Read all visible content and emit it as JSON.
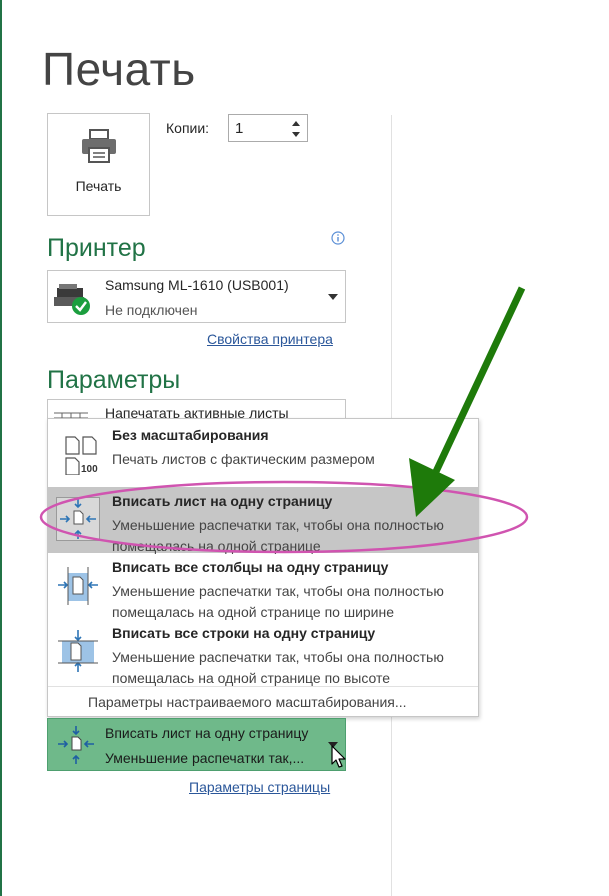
{
  "page": {
    "title": "Печать"
  },
  "print_button": {
    "label": "Печать"
  },
  "copies": {
    "label": "Копии:",
    "value": "1"
  },
  "printer": {
    "section_title": "Принтер",
    "name": "Samsung ML-1610 (USB001)",
    "status": "Не подключен",
    "properties_link": "Свойства принтера"
  },
  "settings": {
    "section_title": "Параметры",
    "active_sheets_text": "Напечатать активные листы"
  },
  "scaling_menu": {
    "items": [
      {
        "title": "Без масштабирования",
        "desc": "Печать листов с фактическим размером",
        "icon": "no-scaling-icon",
        "icon_label": "100"
      },
      {
        "title": "Вписать лист на одну страницу",
        "desc": "Уменьшение распечатки так, чтобы она полностью помещалась на одной странице",
        "icon": "fit-sheet-icon"
      },
      {
        "title": "Вписать все столбцы на одну страницу",
        "desc": "Уменьшение распечатки так, чтобы она полностью помещалась на одной странице по ширине",
        "icon": "fit-columns-icon"
      },
      {
        "title": "Вписать все строки на одну страницу",
        "desc": "Уменьшение распечатки так, чтобы она полностью помещалась на одной странице по высоте",
        "icon": "fit-rows-icon"
      }
    ],
    "custom_options": "Параметры настраиваемого масштабирования..."
  },
  "scaling_select": {
    "title": "Вписать лист на одну страницу",
    "desc": "Уменьшение распечатки так,..."
  },
  "page_setup_link": "Параметры страницы",
  "colors": {
    "accent": "#217346",
    "link": "#2b579a",
    "annotation_arrow": "#1e7a0a",
    "annotation_ellipse": "#d054b0",
    "selected_bg": "#c6c6c6",
    "select_bg": "#6fb98a"
  }
}
